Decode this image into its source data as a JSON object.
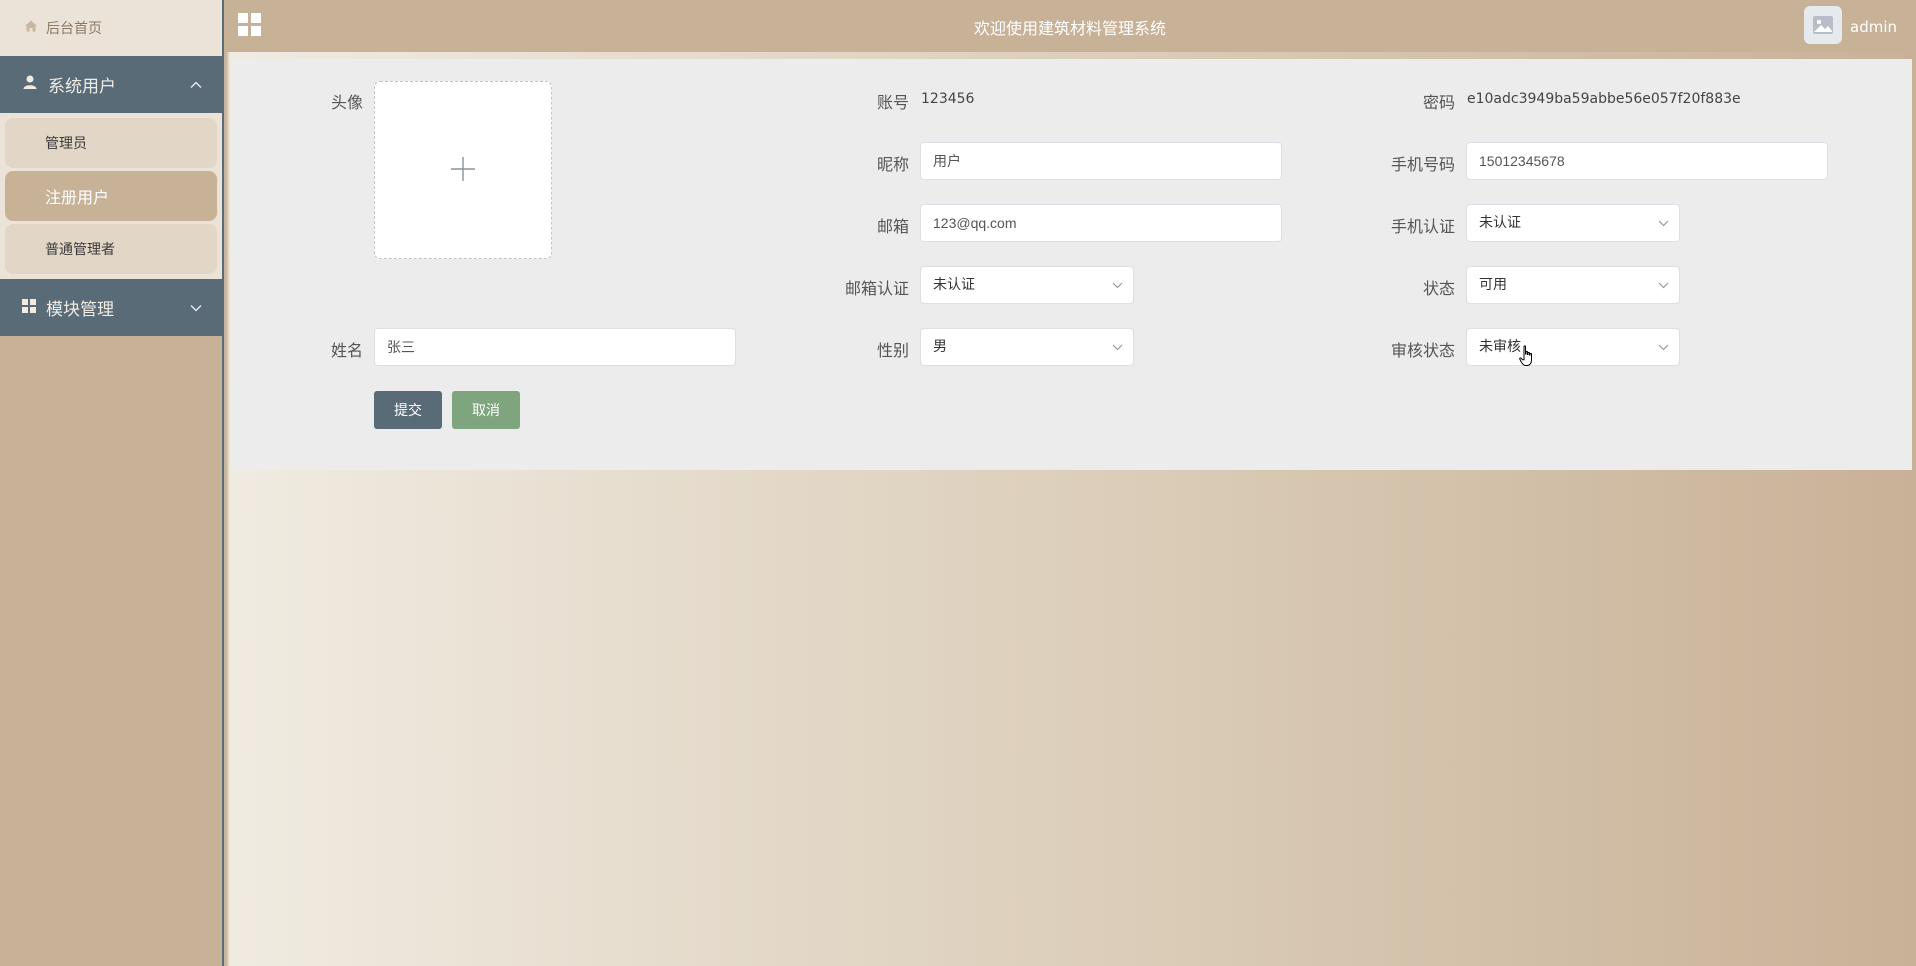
{
  "header": {
    "title": "欢迎使用建筑材料管理系统",
    "user": "admin"
  },
  "sidebar": {
    "home": "后台首页",
    "groups": [
      {
        "label": "系统用户",
        "items": [
          "管理员",
          "注册用户",
          "普通管理者"
        ],
        "active": "注册用户"
      },
      {
        "label": "模块管理"
      }
    ]
  },
  "form": {
    "avatar_label": "头像",
    "account_label": "账号",
    "account_value": "123456",
    "password_label": "密码",
    "password_value": "e10adc3949ba59abbe56e057f20f883e",
    "nickname_label": "昵称",
    "nickname_value": "用户",
    "phone_label": "手机号码",
    "phone_value": "15012345678",
    "email_label": "邮箱",
    "email_value": "123@qq.com",
    "phone_verify_label": "手机认证",
    "phone_verify_value": "未认证",
    "email_verify_label": "邮箱认证",
    "email_verify_value": "未认证",
    "status_label": "状态",
    "status_value": "可用",
    "name_label": "姓名",
    "name_value": "张三",
    "gender_label": "性别",
    "gender_value": "男",
    "review_label": "审核状态",
    "review_value": "未审核",
    "submit": "提交",
    "cancel": "取消"
  }
}
